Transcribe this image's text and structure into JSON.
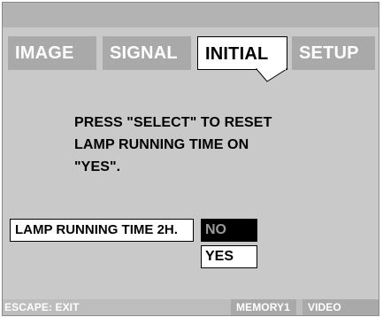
{
  "menu": {
    "tabs": [
      {
        "label": "IMAGE"
      },
      {
        "label": "SIGNAL"
      },
      {
        "label": "INITIAL",
        "active": true
      },
      {
        "label": "SETUP"
      }
    ]
  },
  "message": {
    "lines": [
      "PRESS \"SELECT\" TO RESET",
      "LAMP RUNNING TIME ON",
      "\"YES\"."
    ]
  },
  "setting": {
    "label": "LAMP RUNNING TIME",
    "value": "2H.",
    "options": [
      {
        "label": "NO",
        "selected": true
      },
      {
        "label": "YES",
        "selected": false
      }
    ]
  },
  "footer": {
    "escape": "ESCAPE: EXIT",
    "memory": "MEMORY1",
    "video": "VIDEO"
  },
  "colors": {
    "panel_bg": "#c9c9c9",
    "tab_inactive": "#a9a9a9",
    "tab_active": "#ffffff",
    "selected_option_bg": "#000000"
  }
}
